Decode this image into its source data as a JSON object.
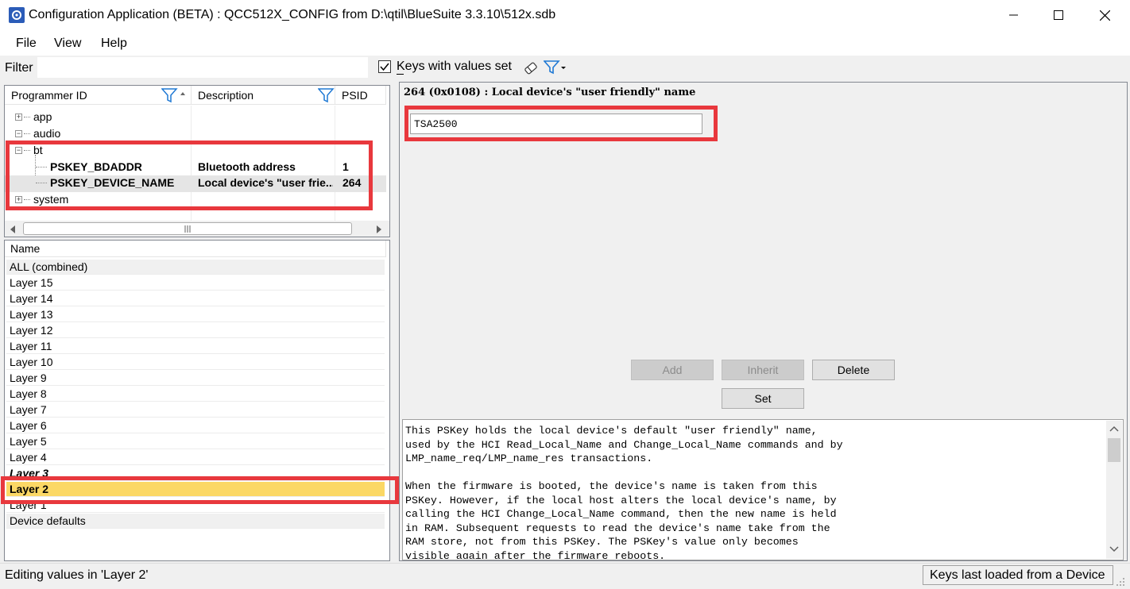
{
  "window": {
    "title": "Configuration Application (BETA) : QCC512X_CONFIG from D:\\qtil\\BlueSuite 3.3.10\\512x.sdb"
  },
  "menu": [
    {
      "label": "File"
    },
    {
      "label": "View"
    },
    {
      "label": "Help"
    }
  ],
  "filter": {
    "label": "Filter",
    "value": "",
    "keys_with_values_label": "Keys with values set",
    "keys_with_values_checked": true
  },
  "tree": {
    "columns": [
      "Programmer ID",
      "Description",
      "PSID"
    ],
    "rows": [
      {
        "id": "app",
        "description": "",
        "psid": "",
        "bold": false
      },
      {
        "id": "audio",
        "description": "",
        "psid": "",
        "bold": false
      },
      {
        "id": "bt",
        "description": "",
        "psid": "",
        "bold": false
      },
      {
        "id": "PSKEY_BDADDR",
        "description": "Bluetooth address",
        "psid": "1",
        "bold": true
      },
      {
        "id": "PSKEY_DEVICE_NAME",
        "description": "Local device's \"user frie...",
        "psid": "264",
        "bold": true
      },
      {
        "id": "system",
        "description": "",
        "psid": "",
        "bold": false
      }
    ]
  },
  "layers": {
    "header": "Name",
    "rows": [
      "ALL (combined)",
      "Layer 15",
      "Layer 14",
      "Layer 13",
      "Layer 12",
      "Layer 11",
      "Layer 10",
      "Layer 9",
      "Layer 8",
      "Layer 7",
      "Layer 6",
      "Layer 5",
      "Layer 4",
      "Layer 3",
      "Layer 2",
      "Layer 1",
      "Device defaults"
    ],
    "selected": "Layer 2"
  },
  "editor": {
    "key_title": "264 (0x0108) : Local device's \"user friendly\" name",
    "value": "TSA2500",
    "buttons": {
      "add": "Add",
      "inherit": "Inherit",
      "delete": "Delete",
      "set": "Set"
    },
    "description": "This PSKey holds the local device's default \"user friendly\" name,\nused by the HCI Read_Local_Name and Change_Local_Name commands and by\nLMP_name_req/LMP_name_res transactions.\n\nWhen the firmware is booted, the device's name is taken from this\nPSKey. However, if the local host alters the local device's name, by\ncalling the HCI Change_Local_Name command, then the new name is held\nin RAM. Subsequent requests to read the device's name take from the\nRAM store, not from this PSKey. The PSKey's value only becomes\nvisible again after the firmware reboots."
  },
  "status": {
    "left": "Editing values in 'Layer 2'",
    "right": "Keys last loaded from a Device"
  },
  "colors": {
    "highlight_red": "#e8383d",
    "selected_row": "#fbd865",
    "app_icon": "#2b5cb8"
  }
}
